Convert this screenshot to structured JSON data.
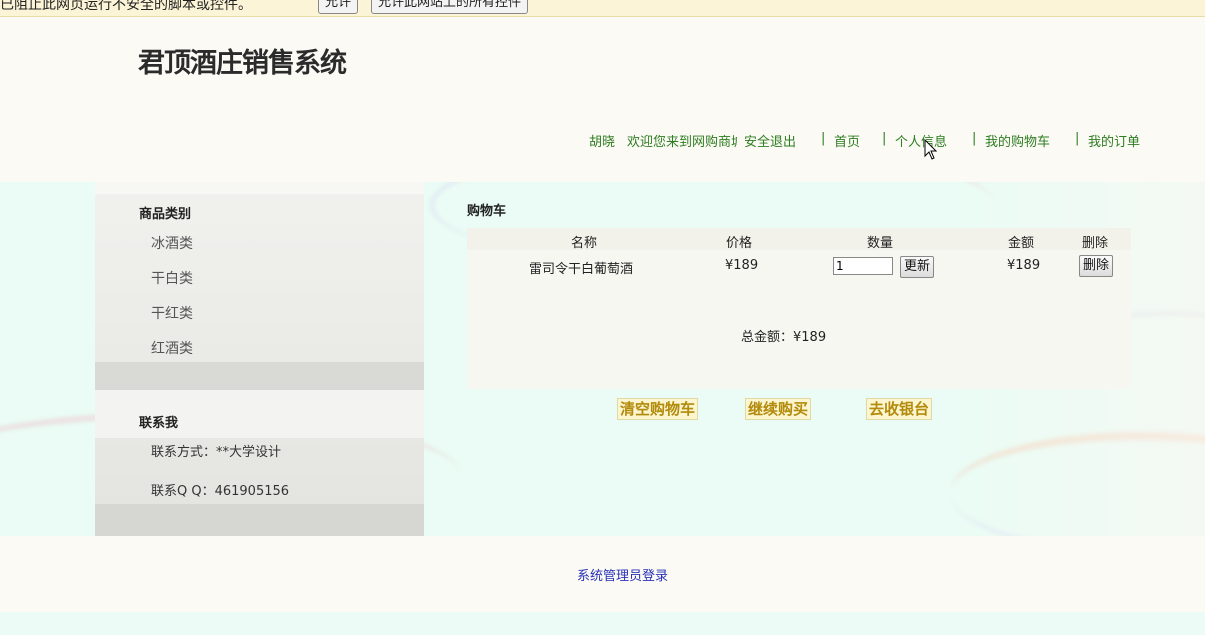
{
  "infobar": {
    "message": "已阻止此网页运行不安全的脚本或控件。",
    "allow_label": "允许",
    "allow_always_label": "允许此网站上的所有控件"
  },
  "header": {
    "site_title": "君顶酒庄销售系统",
    "nav": {
      "user": "胡晓",
      "welcome": "欢迎您来到网购商城",
      "logout": "安全退出",
      "home": "首页",
      "profile": "个人信息",
      "my_cart": "我的购物车",
      "my_orders": "我的订单",
      "separator": "|"
    }
  },
  "sidebar": {
    "categories_title": "商品类别",
    "categories": [
      "冰酒类",
      "干白类",
      "干红类",
      "红酒类"
    ],
    "contact_title": "联系我",
    "contact_method": "联系方式：**大学设计",
    "contact_qq": "联系Q Q：461905156"
  },
  "cart": {
    "title": "购物车",
    "columns": [
      "名称",
      "价格",
      "数量",
      "金额",
      "删除"
    ],
    "rows": [
      {
        "name": "雷司令干白葡萄酒",
        "price": "¥189",
        "quantity": "1",
        "update_label": "更新",
        "amount": "¥189",
        "delete_label": "删除"
      }
    ],
    "total": "总金额：¥189"
  },
  "actions": {
    "clear_cart": "清空购物车",
    "continue_shopping": "继续购买",
    "checkout": "去收银台"
  },
  "footer": {
    "admin_login": "系统管理员登录"
  },
  "colors": {
    "nav_green": "#2e7d21",
    "action_gold": "#b38a0a",
    "link_blue": "#2a33b8",
    "infobar_bg": "#fbf4d6"
  }
}
